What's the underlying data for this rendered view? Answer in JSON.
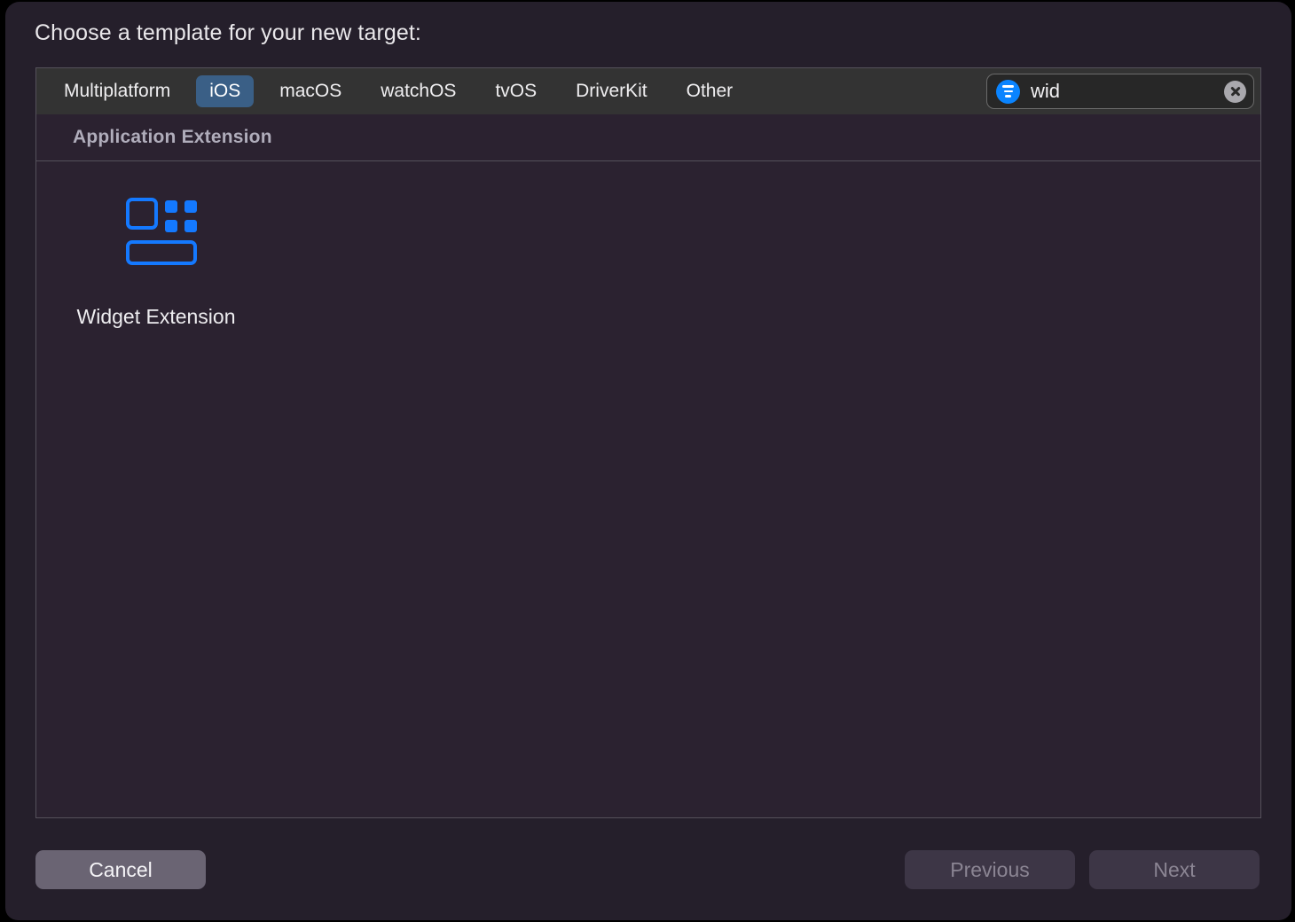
{
  "dialog": {
    "title": "Choose a template for your new target:"
  },
  "tabs": [
    {
      "label": "Multiplatform",
      "selected": false
    },
    {
      "label": "iOS",
      "selected": true
    },
    {
      "label": "macOS",
      "selected": false
    },
    {
      "label": "watchOS",
      "selected": false
    },
    {
      "label": "tvOS",
      "selected": false
    },
    {
      "label": "DriverKit",
      "selected": false
    },
    {
      "label": "Other",
      "selected": false
    }
  ],
  "search": {
    "value": "wid",
    "placeholder": "Filter",
    "filter_icon": "filter-icon",
    "clear_icon": "clear-icon"
  },
  "sections": [
    {
      "header": "Application Extension",
      "templates": [
        {
          "label": "Widget Extension",
          "icon": "widget-extension-icon"
        }
      ]
    }
  ],
  "footer": {
    "cancel_label": "Cancel",
    "previous_label": "Previous",
    "next_label": "Next"
  },
  "colors": {
    "window_background": "#251f2b",
    "panel_background": "#2b2230",
    "tabbar_background": "#333333",
    "selected_tab": "#3a5f86",
    "accent_blue": "#1479ff",
    "filter_blue": "#0a84ff",
    "border": "#54515a"
  }
}
